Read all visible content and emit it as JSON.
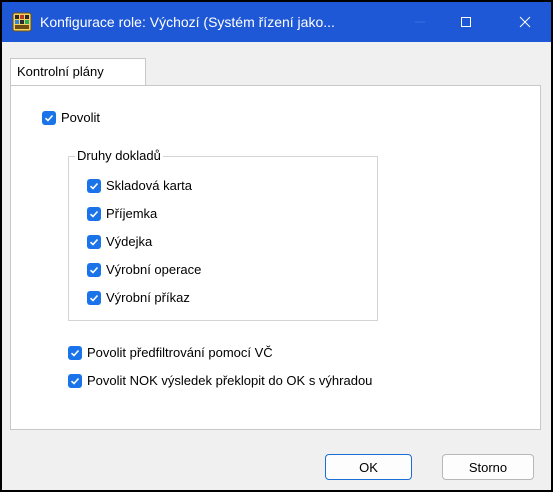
{
  "window": {
    "title": "Konfigurace role: Výchozí (Systém řízení jako...",
    "accent_color": "#1e58d6",
    "icon": "app-grid-icon"
  },
  "tabs": [
    {
      "label": "Kontrolní plány",
      "selected": true
    }
  ],
  "enable": {
    "label": "Povolit",
    "checked": true
  },
  "doc_types": {
    "legend": "Druhy dokladů",
    "items": [
      {
        "label": "Skladová karta",
        "checked": true
      },
      {
        "label": "Příjemka",
        "checked": true
      },
      {
        "label": "Výdejka",
        "checked": true
      },
      {
        "label": "Výrobní operace",
        "checked": true
      },
      {
        "label": "Výrobní příkaz",
        "checked": true
      }
    ]
  },
  "options": [
    {
      "label": "Povolit předfiltrování pomocí VČ",
      "checked": true
    },
    {
      "label": "Povolit NOK výsledek překlopit do OK s výhradou",
      "checked": true
    }
  ],
  "buttons": {
    "ok": "OK",
    "cancel": "Storno"
  }
}
